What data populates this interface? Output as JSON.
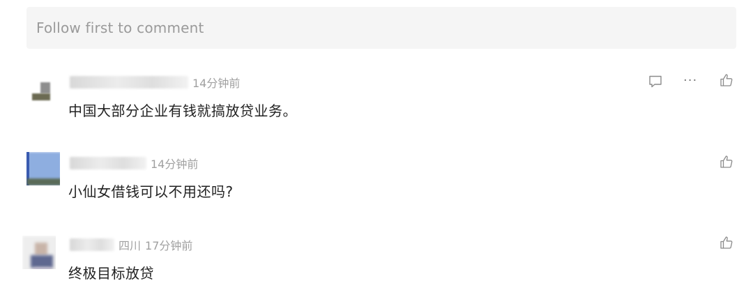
{
  "comment_input": {
    "placeholder": "Follow first to comment"
  },
  "comments": [
    {
      "time": "14分钟前",
      "location": "",
      "text": "中国大部分企业有钱就搞放贷业务。",
      "actions": [
        "reply-icon",
        "more-icon",
        "like-icon"
      ]
    },
    {
      "time": "14分钟前",
      "location": "",
      "text": "小仙女借钱可以不用还吗?",
      "actions": [
        "like-icon"
      ]
    },
    {
      "time": "17分钟前",
      "location": "四川",
      "text": "终极目标放贷",
      "actions": [
        "like-icon"
      ]
    }
  ],
  "icons": {
    "more": "···"
  },
  "colors": {
    "input_bg": "#f5f5f5",
    "placeholder": "#9a9a9a",
    "meta": "#a0a0a0",
    "text": "#222222",
    "icon": "#8a8a8a"
  }
}
